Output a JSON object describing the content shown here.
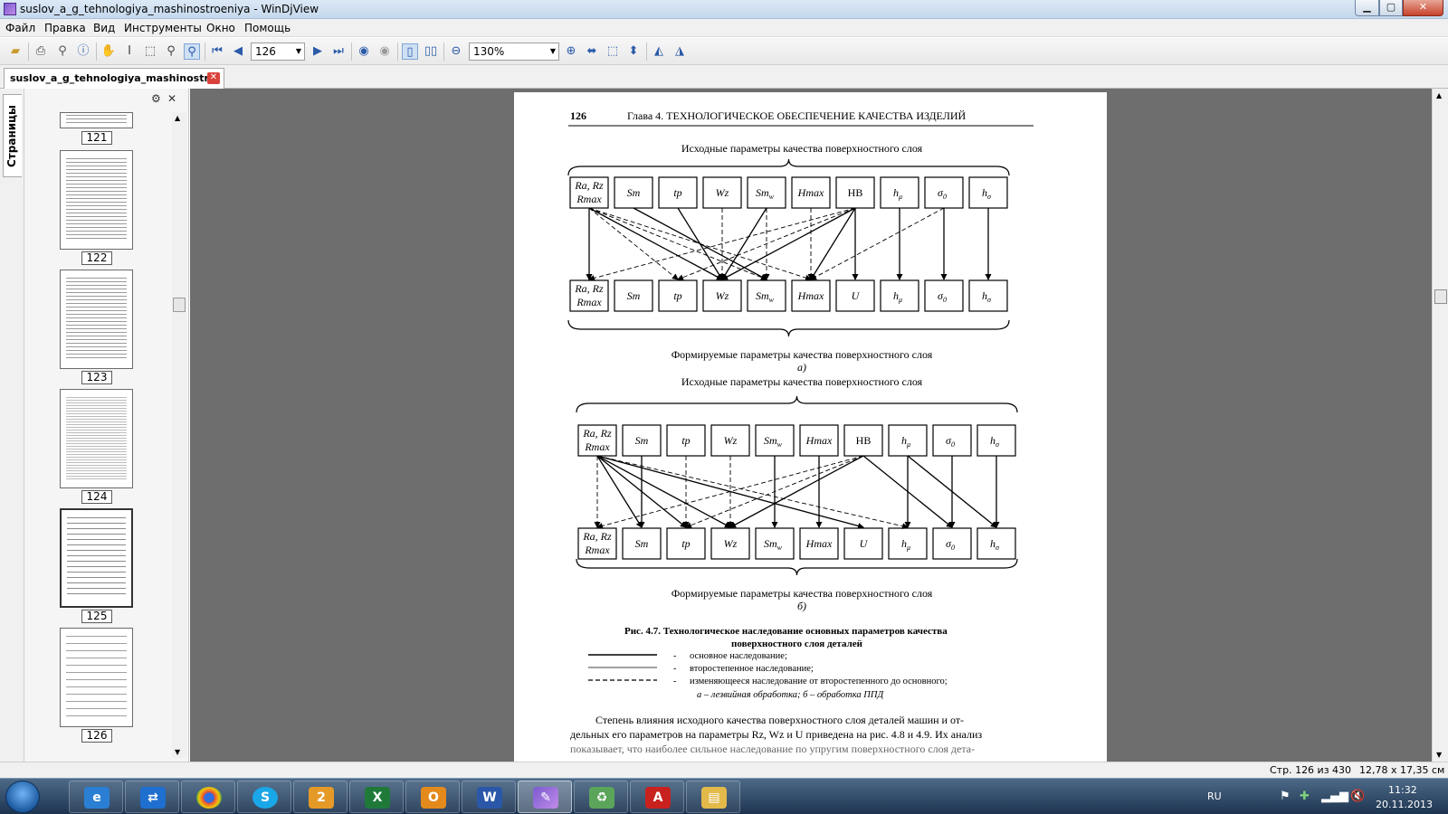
{
  "window": {
    "title": "suslov_a_g_tehnologiya_mashinostroeniya - WinDjView"
  },
  "menu": [
    "Файл",
    "Правка",
    "Вид",
    "Инструменты",
    "Окно",
    "Помощь"
  ],
  "toolbar": {
    "page_number": "126",
    "zoom": "130%"
  },
  "tab": {
    "label": "suslov_a_g_tehnologiya_mashinostr..."
  },
  "sidebar": {
    "tab_label": "Страницы",
    "thumbnails": [
      "121",
      "122",
      "123",
      "124",
      "125",
      "126"
    ]
  },
  "page": {
    "number": "126",
    "header": "Глава 4. ТЕХНОЛОГИЧЕСКОЕ ОБЕСПЕЧЕНИЕ КАЧЕСТВА ИЗДЕЛИЙ",
    "diagram_a": {
      "top_label": "Исходные параметры качества поверхностного слоя",
      "bottom_label": "Формируемые параметры качества поверхностного слоя",
      "sub_label": "а)",
      "top_boxes": [
        "Ra, Rz Rmax",
        "Sm",
        "tp",
        "Wz",
        "Smw",
        "Hmax",
        "HB",
        "hμ",
        "σ0",
        "hσ"
      ],
      "bottom_boxes": [
        "Ra, Rz Rmax",
        "Sm",
        "tp",
        "Wz",
        "Smw",
        "Hmax",
        "U",
        "hμ",
        "σ0",
        "hσ"
      ]
    },
    "diagram_b": {
      "top_label": "Исходные параметры качества поверхностного слоя",
      "bottom_label": "Формируемые параметры качества поверхностного слоя",
      "sub_label": "б)",
      "top_boxes": [
        "Ra, Rz Rmax",
        "Sm",
        "tp",
        "Wz",
        "Smw",
        "Hmax",
        "HB",
        "hμ",
        "σ0",
        "hσ"
      ],
      "bottom_boxes": [
        "Ra, Rz Rmax",
        "Sm",
        "tp",
        "Wz",
        "Smw",
        "Hmax",
        "U",
        "hμ",
        "σ0",
        "hσ"
      ]
    },
    "caption_line1": "Рис. 4.7. Технологическое наследование основных параметров качества",
    "caption_line2": "поверхностного слоя деталей",
    "legend": [
      "основное наследование;",
      "второстепенное наследование;",
      "изменяющееся наследование от второстепенного до основного;"
    ],
    "legend_note": "а – лезвийная обработка; б – обработка ППД",
    "body_line1": "Степень влияния исходного качества поверхностного слоя деталей машин и от-",
    "body_line2": "дельных его параметров на параметры Rz, Wz и U приведена на рис. 4.8 и 4.9. Их анализ",
    "body_line3": "показывает, что наиболее сильное наследование по упругим поверхностного слоя дета-"
  },
  "status": {
    "page_of": "Стр. 126 из 430",
    "size": "12,78 x 17,35 см"
  },
  "taskbar": {
    "lang": "RU",
    "time": "11:32",
    "date": "20.11.2013"
  }
}
